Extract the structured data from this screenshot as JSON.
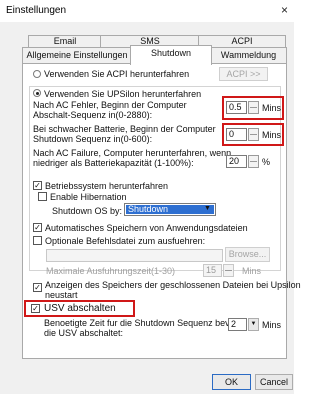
{
  "window": {
    "title": "Einstellungen",
    "close": "×"
  },
  "tabs_row1": [
    "Email",
    "SMS",
    "ACPI"
  ],
  "tabs_row2": [
    "Allgemeine Einstellungen",
    "Shutdown",
    "Wammeldung"
  ],
  "acpi_option": {
    "label": "Verwenden Sie ACPI herunterfahren",
    "button": "ACPI >>"
  },
  "ups_option": {
    "label": "Verwenden Sie UPSilon herunterfahren"
  },
  "ac_fail": {
    "label_line1": "Nach AC Fehler, Beginn der Computer",
    "label_line2": "Abschalt-Sequenz in(0-2880):",
    "value": "0.5",
    "unit": "Mins"
  },
  "low_batt": {
    "label_line1": "Bei schwacher Batterie, Beginn der Computer",
    "label_line2": "Shutdown Sequenz in(0-600):",
    "value": "0",
    "unit": "Mins"
  },
  "capacity": {
    "label_line1": "Nach AC Failure, Computer herunterfahren, wenn",
    "label_line2": "niedriger als Batteriekapazität (1-100%):",
    "value": "20",
    "unit": "%"
  },
  "os_shutdown": {
    "label": "Betriebssystem herunterfahren",
    "hibernation": "Enable Hibernation",
    "os_by_label": "Shutdown OS by:",
    "os_by_value": "Shutdown"
  },
  "autosave": {
    "label": "Automatisches Speichern von Anwendungsdateien"
  },
  "cmdfile": {
    "label": "Optionale Befehlsdatei zum ausfuehren:",
    "browse": "Browse...",
    "max_label": "Maximale Ausfuhrungszeit(1-30)",
    "max_value": "15",
    "max_unit": "Mins"
  },
  "show_files": {
    "label_line1": "Anzeigen des Speichers der geschlossenen Dateien bei Upsilon",
    "label_line2": "neustart"
  },
  "usv_off": {
    "label": "USV abschalten",
    "hint_line1": "Benoetigte Zeit fur die Shutdown Sequenz bevor",
    "hint_line2": "die USV abschaltet:",
    "value": "2",
    "unit": "Mins"
  },
  "buttons": {
    "ok": "OK",
    "cancel": "Cancel"
  },
  "colors": {
    "highlight": "#d01818",
    "selection": "#2e6fd1"
  }
}
